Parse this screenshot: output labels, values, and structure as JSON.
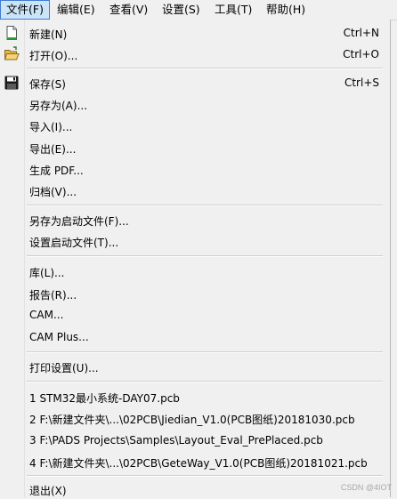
{
  "menubar": {
    "file": "文件(F)",
    "edit": "编辑(E)",
    "view": "查看(V)",
    "setup": "设置(S)",
    "tools": "工具(T)",
    "help": "帮助(H)"
  },
  "file_menu": {
    "new": {
      "label": "新建(N)",
      "shortcut": "Ctrl+N"
    },
    "open": {
      "label": "打开(O)...",
      "shortcut": "Ctrl+O"
    },
    "save": {
      "label": "保存(S)",
      "shortcut": "Ctrl+S"
    },
    "save_as": {
      "label": "另存为(A)..."
    },
    "import": {
      "label": "导入(I)..."
    },
    "export": {
      "label": "导出(E)..."
    },
    "generate_pdf": {
      "label": "生成 PDF..."
    },
    "archive": {
      "label": "归档(V)..."
    },
    "save_as_startup": {
      "label": "另存为启动文件(F)..."
    },
    "set_startup": {
      "label": "设置启动文件(T)..."
    },
    "library": {
      "label": "库(L)..."
    },
    "reports": {
      "label": "报告(R)..."
    },
    "cam": {
      "label": "CAM..."
    },
    "cam_plus": {
      "label": "CAM Plus..."
    },
    "print_setup": {
      "label": "打印设置(U)..."
    },
    "recent_files": [
      "1 STM32最小系统-DAY07.pcb",
      "2 F:\\新建文件夹\\...\\02PCB\\Jiedian_V1.0(PCB图纸)20181030.pcb",
      "3 F:\\PADS Projects\\Samples\\Layout_Eval_PrePlaced.pcb",
      "4 F:\\新建文件夹\\...\\02PCB\\GeteWay_V1.0(PCB图纸)20181021.pcb"
    ],
    "exit": {
      "label": "退出(X)"
    }
  },
  "watermark": "CSDN @4IOT",
  "icons": {
    "new": "new-document-icon",
    "open": "open-folder-icon",
    "save": "floppy-disk-icon"
  },
  "colors": {
    "menu_bg": "#f0f0f0",
    "active_bg": "#cce4f7",
    "active_border": "#3f7ecf"
  }
}
